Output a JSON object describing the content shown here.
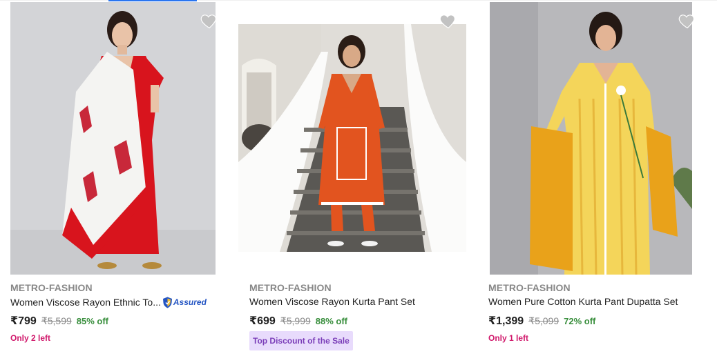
{
  "products": [
    {
      "brand": "METRO-FASHION",
      "title": "Women Viscose Rayon Ethnic To...",
      "assured_label": "Assured",
      "price": "₹799",
      "mrp": "₹5,599",
      "discount": "85% off",
      "stock_note": "Only 2 left",
      "image_alt": "woman in red long kurta with white printed dupatta",
      "wishlist_icon": "heart-icon"
    },
    {
      "brand": "METRO-FASHION",
      "title": "Women Viscose Rayon Kurta Pant Set",
      "price": "₹699",
      "mrp": "₹5,999",
      "discount": "88% off",
      "promo_tag": "Top Discount of the Sale",
      "image_alt": "woman in orange kurta pant set on stairs",
      "wishlist_icon": "heart-icon"
    },
    {
      "brand": "METRO-FASHION",
      "title": "Women Pure Cotton Kurta Pant Dupatta Set",
      "price": "₹1,399",
      "mrp": "₹5,099",
      "discount": "72% off",
      "stock_note": "Only 1 left",
      "image_alt": "woman in yellow printed kurta with mustard dupatta",
      "wishlist_icon": "heart-icon"
    }
  ],
  "colors": {
    "brand_text": "#878787",
    "discount_green": "#388e3c",
    "stock_pink": "#d0186b",
    "promo_bg": "#e8dbfc",
    "promo_text": "#7a3db8",
    "assured_blue": "#2455c3",
    "wishlist_grey": "#c2c2c2"
  }
}
